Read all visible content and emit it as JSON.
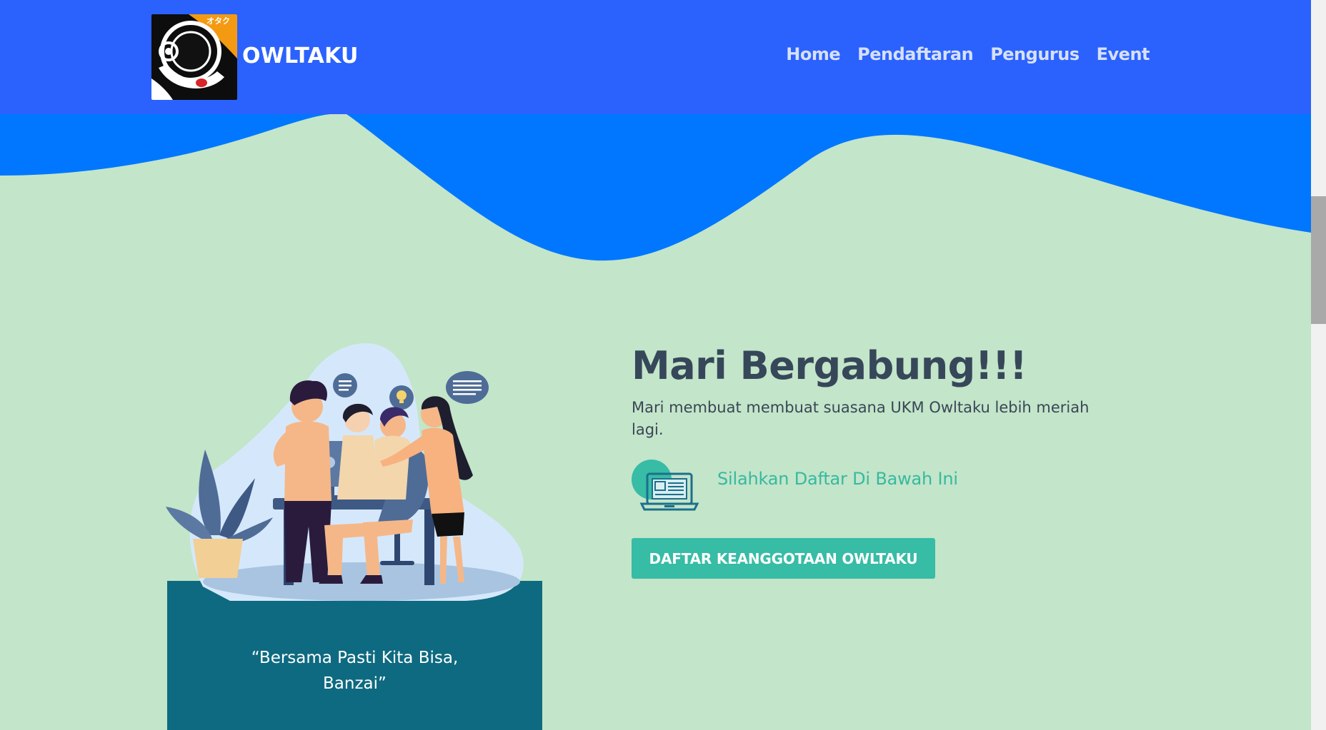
{
  "header": {
    "brand_name": "OWLTAKU",
    "logo_text": "オタク",
    "nav": [
      {
        "label": "Home"
      },
      {
        "label": "Pendaftaran"
      },
      {
        "label": "Pengurus"
      },
      {
        "label": "Event"
      }
    ]
  },
  "hero": {
    "title": "Mari Bergabung!!!",
    "description": "Mari membuat membuat suasana UKM Owltaku lebih meriah lagi.",
    "cta_text": "Silahkan Daftar Di Bawah Ini",
    "button_label": "DAFTAR KEANGGOTAAN OWLTAKU",
    "quote": "“Bersama Pasti Kita Bisa, Banzai”"
  },
  "colors": {
    "header_bg": "#2b62fe",
    "wave_blue": "#0077fe",
    "page_bg": "#c3e5c9",
    "accent_teal": "#37bca6",
    "quote_bg": "#0e6a80"
  }
}
